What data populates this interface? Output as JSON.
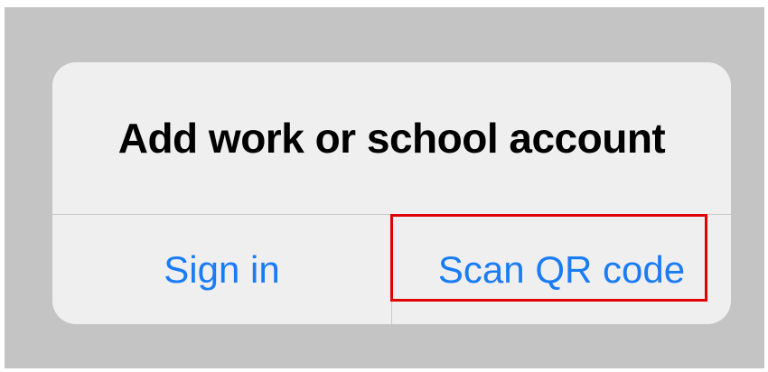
{
  "alert": {
    "title": "Add work or school account",
    "actions": [
      {
        "label": "Sign in"
      },
      {
        "label": "Scan QR code"
      }
    ]
  },
  "colors": {
    "backdrop": "#c4c4c4",
    "alert_background": "#efefef",
    "action_text": "#1a7cf5",
    "highlight_border": "#e00000"
  }
}
